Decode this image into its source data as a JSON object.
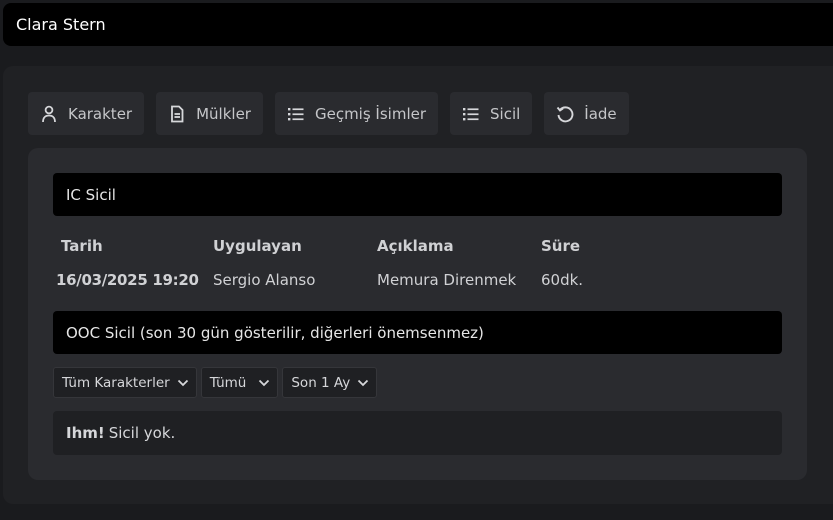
{
  "window": {
    "title": "Clara Stern"
  },
  "tabs": [
    {
      "label": "Karakter",
      "icon": "person-icon"
    },
    {
      "label": "Mülkler",
      "icon": "document-icon"
    },
    {
      "label": "Geçmiş İsimler",
      "icon": "list-icon"
    },
    {
      "label": "Sicil",
      "icon": "list-icon"
    },
    {
      "label": "İade",
      "icon": "undo-icon"
    }
  ],
  "ic_record": {
    "title": "IC Sicil",
    "columns": [
      "Tarih",
      "Uygulayan",
      "Açıklama",
      "Süre"
    ],
    "rows": [
      [
        "16/03/2025 19:20",
        "Sergio Alanso",
        "Memura Direnmek",
        "60dk."
      ]
    ]
  },
  "ooc_record": {
    "title": "OOC Sicil (son 30 gün gösterilir, diğerleri önemsenmez)",
    "filters": {
      "character": "Tüm Karakterler",
      "type": "Tümü",
      "period": "Son 1 Ay"
    },
    "empty_bold": "Ihm!",
    "empty_text": "Sicil yok."
  },
  "colors": {
    "background": "#1a1b1e",
    "panel": "#202124",
    "inner_panel": "#2a2b2f",
    "header_bar": "#000000"
  }
}
